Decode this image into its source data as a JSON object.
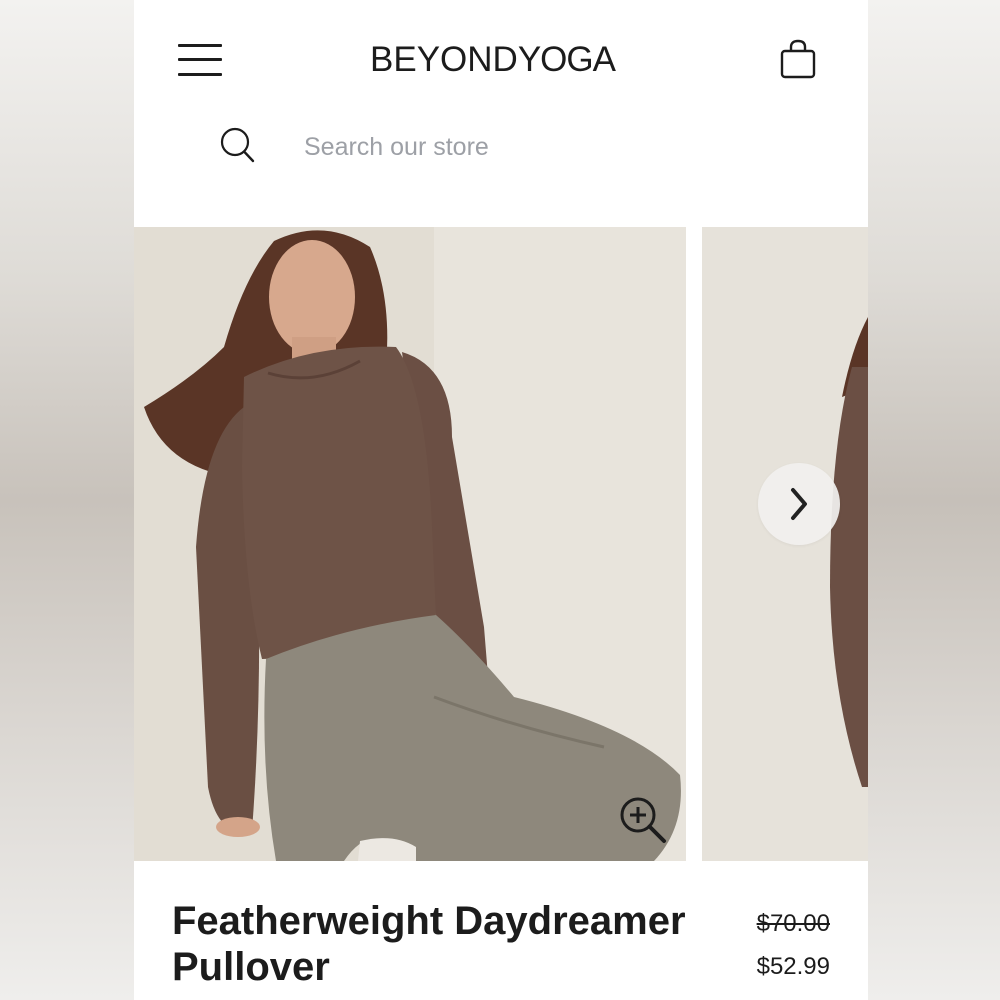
{
  "header": {
    "logo_part1": "BEYOND",
    "logo_part2": "YOGA",
    "menu_icon": "hamburger-menu-icon",
    "cart_icon": "shopping-bag-icon"
  },
  "search": {
    "placeholder": "Search our store",
    "value": "",
    "icon": "search-icon"
  },
  "gallery": {
    "zoom_icon": "zoom-in-icon",
    "next_icon": "chevron-right-icon"
  },
  "product": {
    "title": "Featherweight Daydreamer Pullover",
    "original_price": "$70.00",
    "sale_price": "$52.99"
  },
  "colors": {
    "text": "#1c1c1c",
    "placeholder": "#9da0a6",
    "photo_background": "#e5e1d8",
    "pullover": "#6e5347",
    "leggings": "#8e887c"
  }
}
